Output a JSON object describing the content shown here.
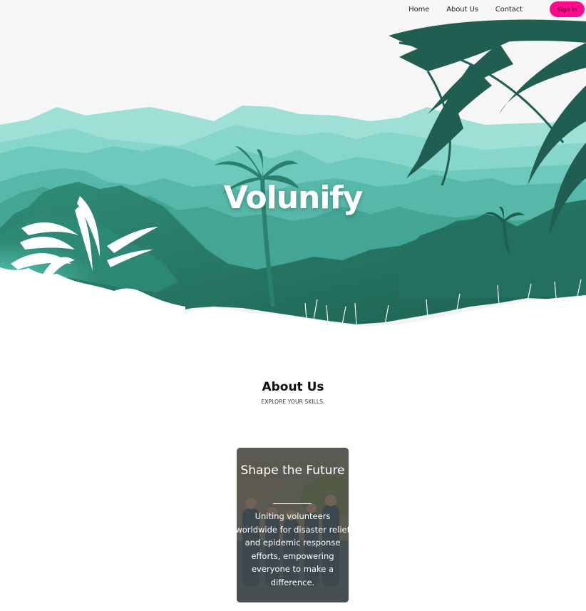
{
  "nav": {
    "links": [
      "Home",
      "About Us",
      "Contact"
    ],
    "signin_label": "Sign In"
  },
  "hero": {
    "title": "Volunify"
  },
  "about": {
    "title": "About Us",
    "subtitle": "EXPLORE YOUR SKILLS."
  },
  "card": {
    "title": "Shape the Future",
    "text": "Uniting volunteers worldwide for disaster relief and epidemic response efforts, empowering everyone to make a difference."
  },
  "colors": {
    "accent": "#ff0a8c",
    "teal_light": "#8fdcd2",
    "teal_mid": "#4fb8a8",
    "teal_dark": "#1f6b5a"
  }
}
